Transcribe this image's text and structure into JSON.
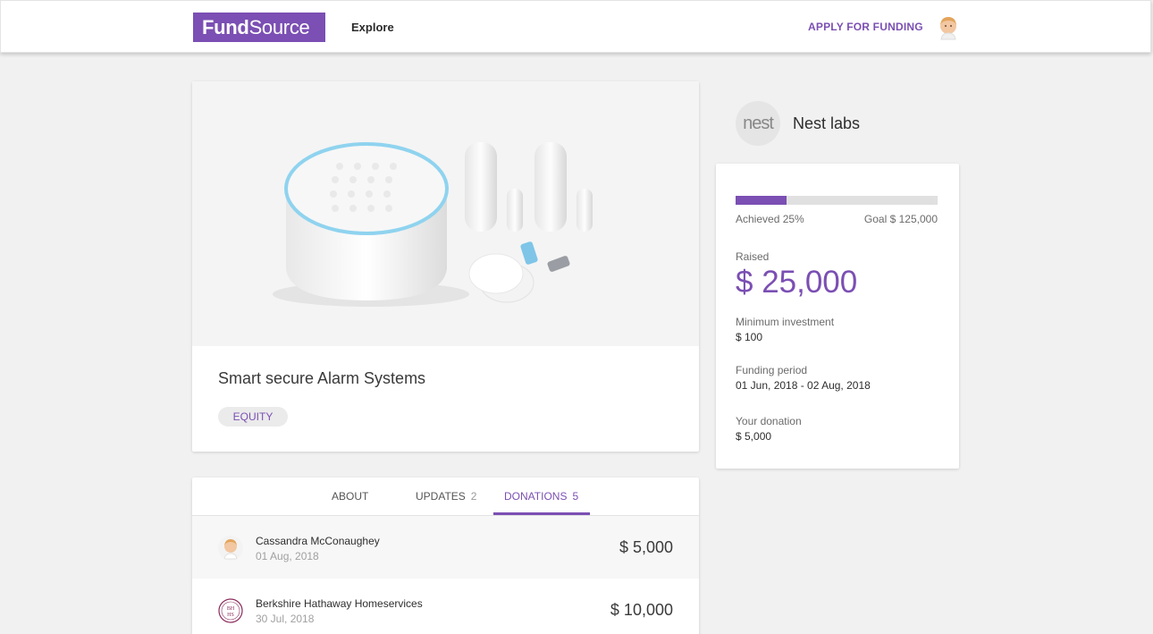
{
  "header": {
    "logo_bold": "Fund",
    "logo_rest": "Source",
    "nav_explore": "Explore",
    "apply_label": "APPLY FOR FUNDING"
  },
  "project": {
    "title": "Smart secure Alarm Systems",
    "tag": "EQUITY"
  },
  "company": {
    "logo_text": "nest",
    "name": "Nest labs"
  },
  "funding": {
    "progress_fraction": 0.25,
    "achieved_label": "Achieved 25%",
    "goal_label": "Goal $ 125,000",
    "raised_label": "Raised",
    "raised_value": "$ 25,000",
    "min_label": "Minimum investment",
    "min_value": "$ 100",
    "period_label": "Funding period",
    "period_value": "01 Jun, 2018 - 02 Aug, 2018",
    "donation_label": "Your donation",
    "donation_value": "$ 5,000"
  },
  "tabs": [
    {
      "label": "ABOUT",
      "count": ""
    },
    {
      "label": "UPDATES",
      "count": "2"
    },
    {
      "label": "DONATIONS",
      "count": "5"
    }
  ],
  "donations": [
    {
      "name": "Cassandra McConaughey",
      "date": "01 Aug, 2018",
      "amount": "$ 5,000"
    },
    {
      "name": "Berkshire Hathaway Homeservices",
      "date": "30 Jul, 2018",
      "amount": "$ 10,000",
      "logo_text": "BH HS"
    }
  ],
  "colors": {
    "accent": "#7b4fb3",
    "background": "#f1f1f1"
  }
}
